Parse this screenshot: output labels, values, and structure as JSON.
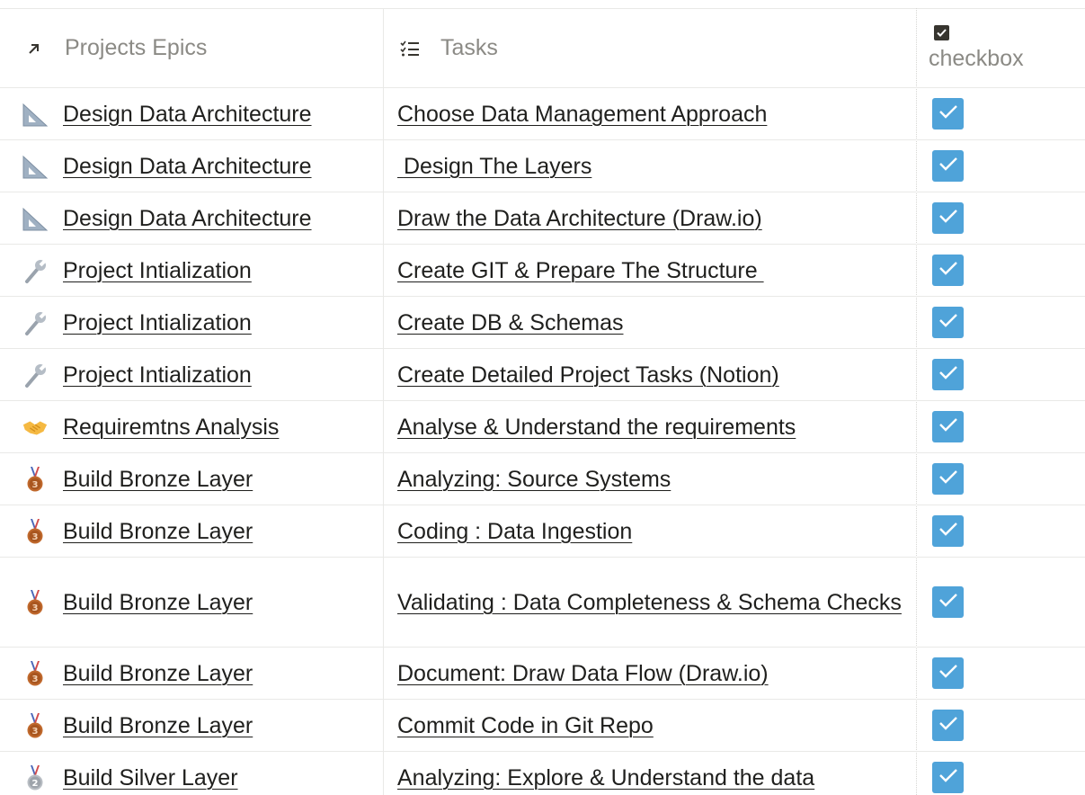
{
  "header": {
    "epics_label": "Projects Epics",
    "tasks_label": "Tasks",
    "checkbox_label": "checkbox"
  },
  "rows": [
    {
      "epic": "Design Data Architecture",
      "epic_icon": "triangular-ruler-icon",
      "task": "Choose Data Management Approach",
      "checked": true
    },
    {
      "epic": "Design Data Architecture",
      "epic_icon": "triangular-ruler-icon",
      "task": " Design The Layers",
      "checked": true
    },
    {
      "epic": "Design Data Architecture",
      "epic_icon": "triangular-ruler-icon",
      "task": "Draw the Data Architecture (Draw.io)",
      "checked": true
    },
    {
      "epic": "Project Intialization",
      "epic_icon": "wrench-icon",
      "task": "Create GIT & Prepare The Structure ",
      "checked": true
    },
    {
      "epic": "Project Intialization",
      "epic_icon": "wrench-icon",
      "task": "Create DB & Schemas",
      "checked": true
    },
    {
      "epic": "Project Intialization",
      "epic_icon": "wrench-icon",
      "task": "Create Detailed Project Tasks (Notion)",
      "checked": true
    },
    {
      "epic": "Requiremtns Analysis",
      "epic_icon": "handshake-icon",
      "task": "Analyse & Understand the requirements",
      "checked": true
    },
    {
      "epic": "Build Bronze Layer",
      "epic_icon": "bronze-medal-icon",
      "task": "Analyzing: Source Systems",
      "checked": true
    },
    {
      "epic": "Build Bronze Layer",
      "epic_icon": "bronze-medal-icon",
      "task": "Coding : Data Ingestion",
      "checked": true
    },
    {
      "epic": "Build Bronze Layer",
      "epic_icon": "bronze-medal-icon",
      "task": "Validating : Data Completeness & Schema Checks",
      "checked": true
    },
    {
      "epic": "Build Bronze Layer",
      "epic_icon": "bronze-medal-icon",
      "task": "Document: Draw Data Flow (Draw.io)",
      "checked": true
    },
    {
      "epic": "Build Bronze Layer",
      "epic_icon": "bronze-medal-icon",
      "task": "Commit Code in Git Repo",
      "checked": true
    },
    {
      "epic": "Build Silver Layer",
      "epic_icon": "silver-medal-icon",
      "task": "Analyzing: Explore & Understand the data",
      "checked": true
    }
  ],
  "colors": {
    "checkbox_fill": "#4fa3d9",
    "grid_line": "#e9e9e7",
    "header_text": "#8b8a85"
  }
}
